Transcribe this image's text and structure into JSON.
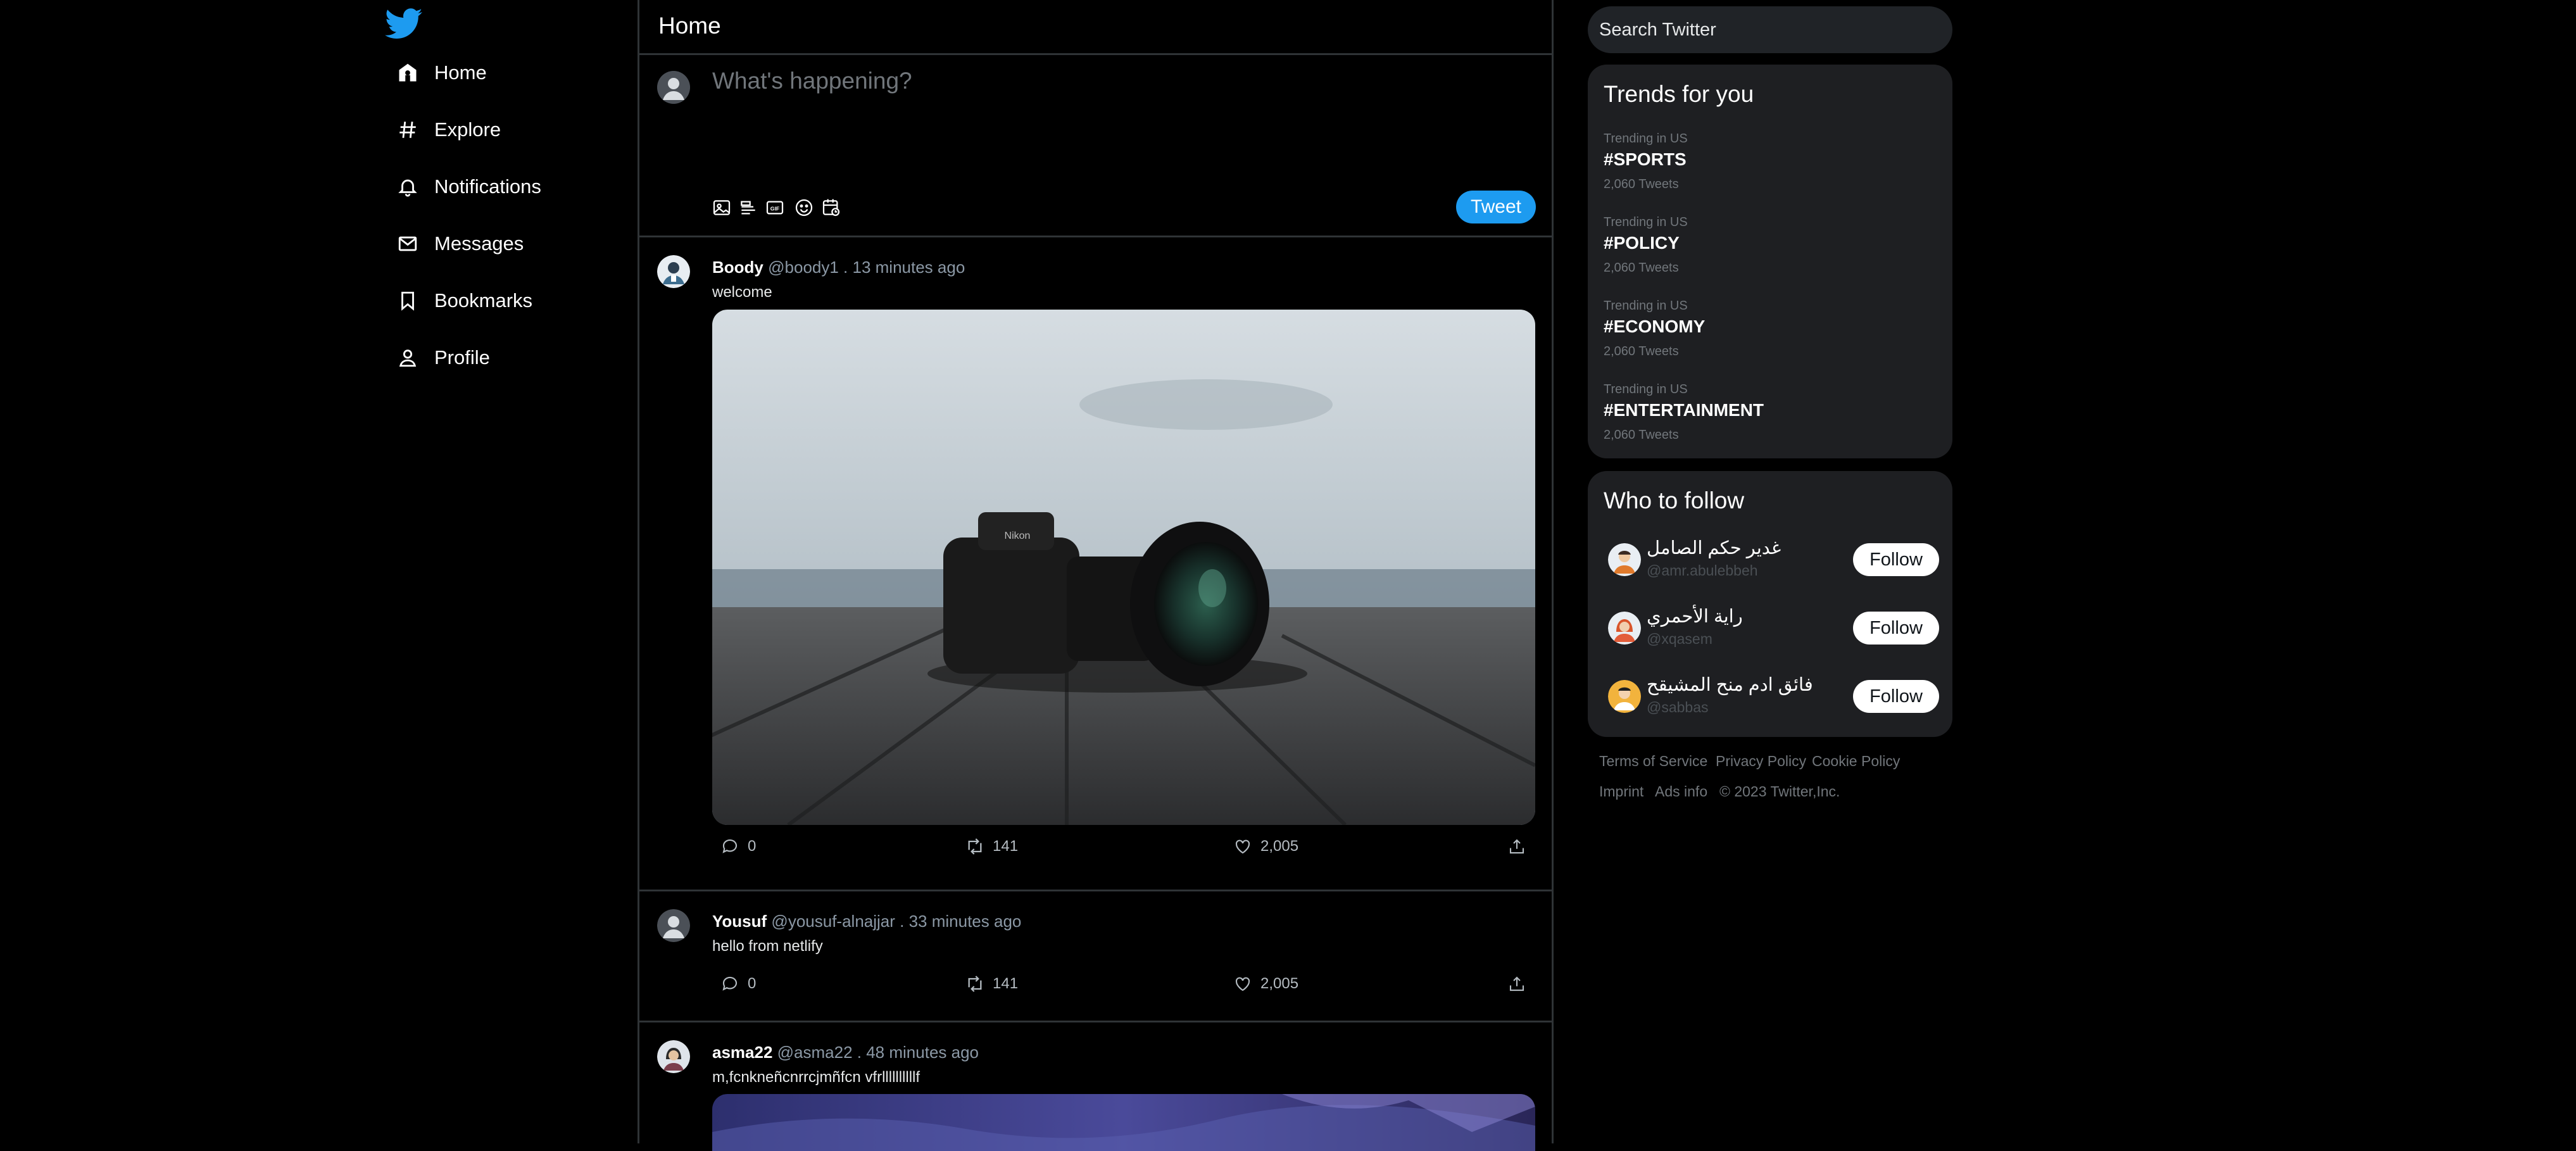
{
  "nav": {
    "logo": "twitter-bird",
    "items": [
      {
        "label": "Home",
        "icon": "home-icon"
      },
      {
        "label": "Explore",
        "icon": "hashtag-icon"
      },
      {
        "label": "Notifications",
        "icon": "bell-icon"
      },
      {
        "label": "Messages",
        "icon": "mail-icon"
      },
      {
        "label": "Bookmarks",
        "icon": "bookmark-icon"
      },
      {
        "label": "Profile",
        "icon": "person-icon"
      }
    ]
  },
  "header": {
    "title": "Home"
  },
  "compose": {
    "placeholder": "What's happening?",
    "tools": [
      "image-icon",
      "gif-list-icon",
      "gif-icon",
      "emoji-icon",
      "schedule-icon"
    ],
    "tweet_label": "Tweet"
  },
  "posts": [
    {
      "name": "Boody",
      "meta": "@boody1 . 13 minutes ago",
      "text": "welcome",
      "has_media": true,
      "media": "camera-photo",
      "replies": "0",
      "retweets": "141",
      "likes": "2,005"
    },
    {
      "name": "Yousuf",
      "meta": "@yousuf-alnajjar . 33 minutes ago",
      "text": "hello from netlify",
      "has_media": false,
      "replies": "0",
      "retweets": "141",
      "likes": "2,005"
    },
    {
      "name": "asma22",
      "meta": "@asma22 . 48 minutes ago",
      "text": "m,fcnkneñcnrrcjmñfcn vfrllllllllllf",
      "has_media": true,
      "media": "purple-artwork"
    }
  ],
  "search": {
    "placeholder": "Search Twitter"
  },
  "trends": {
    "title": "Trends for you",
    "items": [
      {
        "category": "Trending in US",
        "tag": "#SPORTS",
        "count": "2,060 Tweets"
      },
      {
        "category": "Trending in US",
        "tag": "#POLICY",
        "count": "2,060 Tweets"
      },
      {
        "category": "Trending in US",
        "tag": "#ECONOMY",
        "count": "2,060 Tweets"
      },
      {
        "category": "Trending in US",
        "tag": "#ENTERTAINMENT",
        "count": "2,060 Tweets"
      }
    ]
  },
  "who_to_follow": {
    "title": "Who to follow",
    "follow_label": "Follow",
    "users": [
      {
        "name": "غدير حكم الصامل",
        "handle": "@amr.abulebbeh"
      },
      {
        "name": "راية الأحمري",
        "handle": "@xqasem"
      },
      {
        "name": "فائق ادم منح المشيقح",
        "handle": "@sabbas"
      }
    ]
  },
  "footer": {
    "links": [
      "Terms of Service",
      "Privacy Policy",
      "Cookie Policy",
      "Imprint",
      "Ads info",
      "© 2023 Twitter,Inc."
    ]
  },
  "colors": {
    "accent": "#1d9bf0",
    "background": "#000000",
    "panel": "#1e1f22",
    "border": "#2f3336"
  }
}
